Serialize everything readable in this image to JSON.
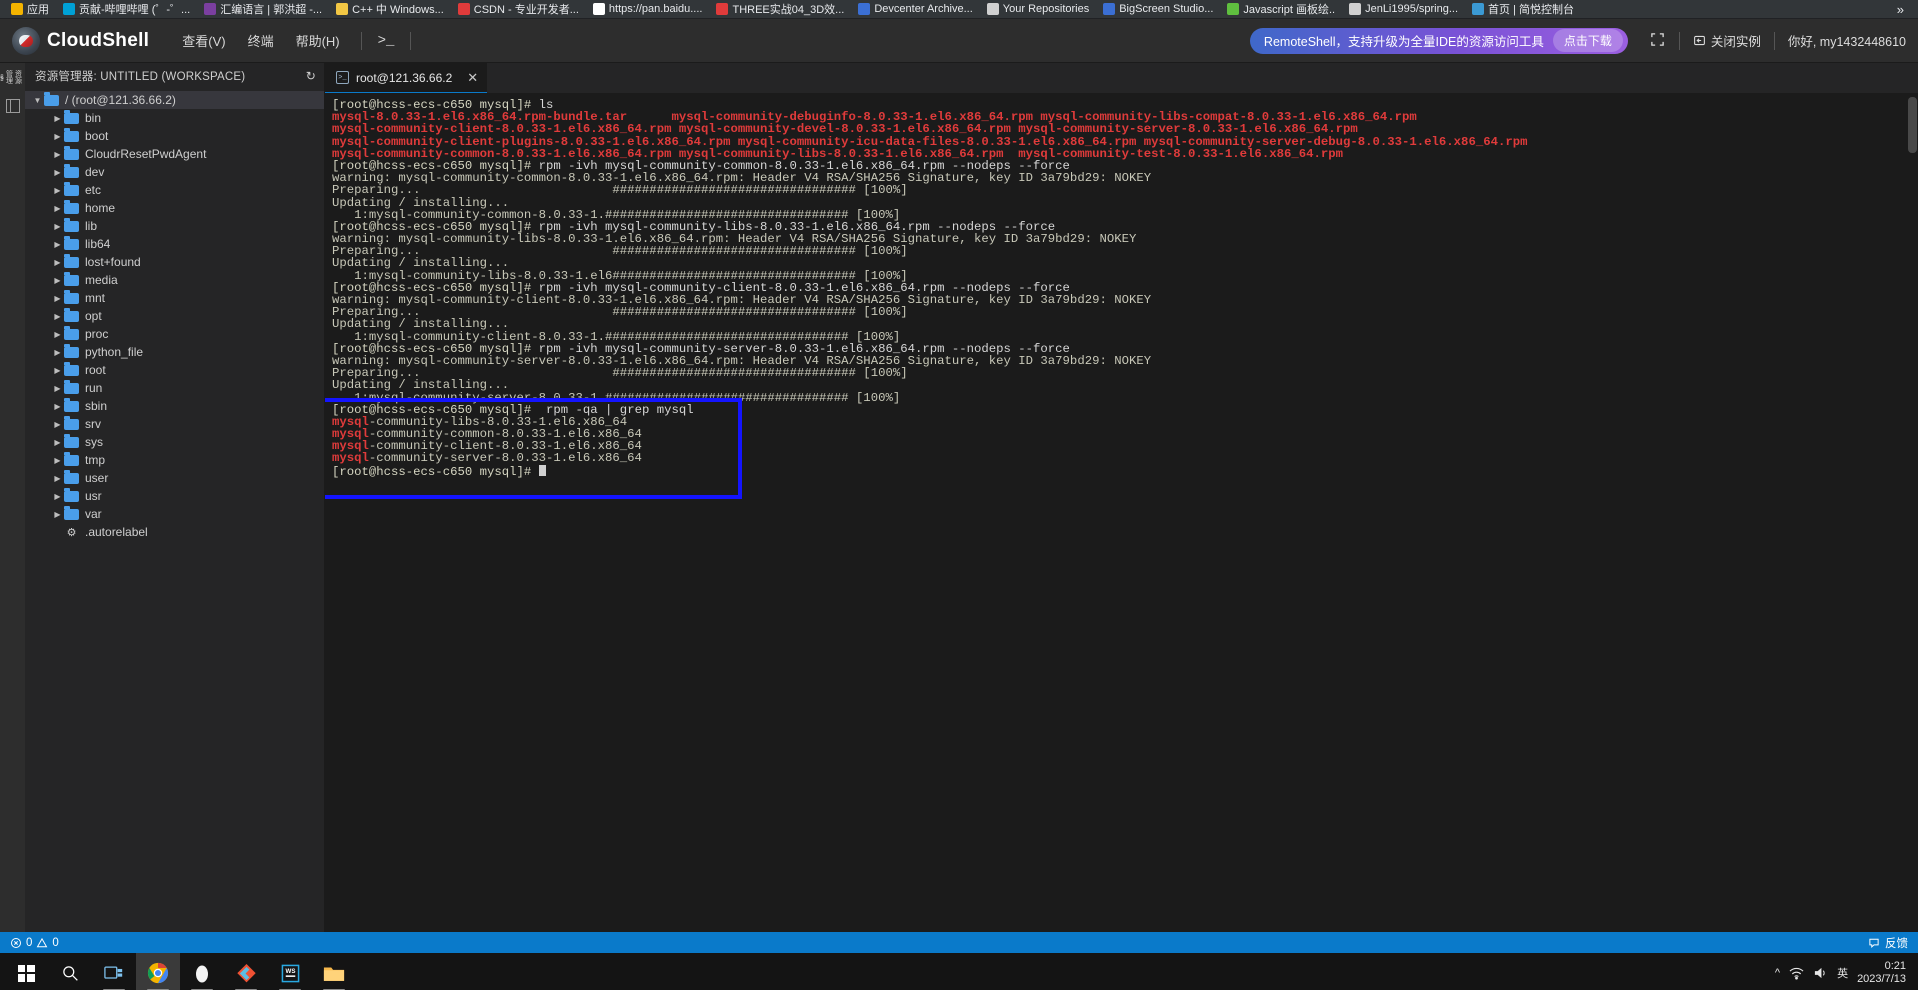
{
  "browser": {
    "bookmarks": [
      {
        "label": "应用",
        "icon": "apps-grid-icon",
        "color": "#f4b400"
      },
      {
        "label": "贡献-哔哩哔哩 (゜-゜...",
        "icon": "bilibili-icon",
        "color": "#00a1d6"
      },
      {
        "label": "汇编语言 | 郭洪超 -...",
        "icon": "note-icon",
        "color": "#7b3fa0"
      },
      {
        "label": "C++ 中 Windows...",
        "icon": "document-icon",
        "color": "#f2c744"
      },
      {
        "label": "CSDN - 专业开发者...",
        "icon": "csdn-icon",
        "color": "#e03b3b"
      },
      {
        "label": "https://pan.baidu....",
        "icon": "baidu-icon",
        "color": "#ffffff"
      },
      {
        "label": "THREE实战04_3D效...",
        "icon": "csdn-icon",
        "color": "#e03b3b"
      },
      {
        "label": "Devcenter Archive...",
        "icon": "devcenter-icon",
        "color": "#3b6fd4"
      },
      {
        "label": "Your Repositories",
        "icon": "github-icon",
        "color": "#d0d0d0"
      },
      {
        "label": "BigScreen Studio...",
        "icon": "bigscreen-icon",
        "color": "#3b6fd4"
      },
      {
        "label": "Javascript 画板绘..",
        "icon": "leaf-icon",
        "color": "#5fbf3f"
      },
      {
        "label": "JenLi1995/spring...",
        "icon": "github-icon",
        "color": "#d0d0d0"
      },
      {
        "label": "首页 | 简悦控制台",
        "icon": "console-icon",
        "color": "#3b9ad4"
      }
    ],
    "overflow": "»"
  },
  "header": {
    "app_title": "CloudShell",
    "logo_icon": "cloudshell-logo-icon",
    "menus": [
      {
        "label": "查看(V)",
        "name": "menu-view"
      },
      {
        "label": "终端",
        "name": "menu-terminal"
      },
      {
        "label": "帮助(H)",
        "name": "menu-help"
      }
    ],
    "terminal_icon_glyph": ">_",
    "promo_text": "RemoteShell，支持升级为全量IDE的资源访问工具",
    "promo_cta": "点击下载",
    "fullscreen_icon": "fullscreen-icon",
    "close_instance": "关闭实例",
    "close_instance_icon": "power-close-icon",
    "greeting": "你好, my1432448610"
  },
  "rail": {
    "items": [
      {
        "label": "资源管理器",
        "name": "rail-explorer"
      },
      {
        "label": "",
        "name": "rail-files"
      }
    ]
  },
  "explorer": {
    "title": "资源管理器: UNTITLED (WORKSPACE)",
    "refresh_icon": "refresh-icon",
    "root": {
      "label": "/ (root@121.36.66.2)",
      "expanded": true
    },
    "items": [
      {
        "label": "bin",
        "type": "folder"
      },
      {
        "label": "boot",
        "type": "folder"
      },
      {
        "label": "CloudrResetPwdAgent",
        "type": "folder"
      },
      {
        "label": "dev",
        "type": "folder"
      },
      {
        "label": "etc",
        "type": "folder"
      },
      {
        "label": "home",
        "type": "folder"
      },
      {
        "label": "lib",
        "type": "folder"
      },
      {
        "label": "lib64",
        "type": "folder"
      },
      {
        "label": "lost+found",
        "type": "folder"
      },
      {
        "label": "media",
        "type": "folder"
      },
      {
        "label": "mnt",
        "type": "folder"
      },
      {
        "label": "opt",
        "type": "folder"
      },
      {
        "label": "proc",
        "type": "folder"
      },
      {
        "label": "python_file",
        "type": "folder"
      },
      {
        "label": "root",
        "type": "folder"
      },
      {
        "label": "run",
        "type": "folder"
      },
      {
        "label": "sbin",
        "type": "folder"
      },
      {
        "label": "srv",
        "type": "folder"
      },
      {
        "label": "sys",
        "type": "folder"
      },
      {
        "label": "tmp",
        "type": "folder"
      },
      {
        "label": "user",
        "type": "folder"
      },
      {
        "label": "usr",
        "type": "folder"
      },
      {
        "label": "var",
        "type": "folder"
      },
      {
        "label": ".autorelabel",
        "type": "file"
      }
    ]
  },
  "terminal": {
    "tab_label": "root@121.36.66.2",
    "tab_icon": "terminal-icon",
    "tab_close_icon": "close-icon",
    "prompt": "[root@hcss-ecs-c650 mysql]#",
    "annotation_color": "#1414ff",
    "lines": [
      {
        "type": "cmd",
        "prompt": "[root@hcss-ecs-c650 mysql]# ",
        "text": "ls"
      },
      {
        "type": "cols",
        "cols": [
          "mysql-8.0.33-1.el6.x86_64.rpm-bundle.tar",
          "mysql-community-debuginfo-8.0.33-1.el6.x86_64.rpm",
          "mysql-community-libs-compat-8.0.33-1.el6.x86_64.rpm"
        ]
      },
      {
        "type": "cols",
        "cols": [
          "mysql-community-client-8.0.33-1.el6.x86_64.rpm",
          "mysql-community-devel-8.0.33-1.el6.x86_64.rpm",
          "mysql-community-server-8.0.33-1.el6.x86_64.rpm"
        ]
      },
      {
        "type": "cols",
        "cols": [
          "mysql-community-client-plugins-8.0.33-1.el6.x86_64.rpm",
          "mysql-community-icu-data-files-8.0.33-1.el6.x86_64.rpm",
          "mysql-community-server-debug-8.0.33-1.el6.x86_64.rpm"
        ]
      },
      {
        "type": "cols",
        "cols": [
          "mysql-community-common-8.0.33-1.el6.x86_64.rpm",
          "mysql-community-libs-8.0.33-1.el6.x86_64.rpm",
          "mysql-community-test-8.0.33-1.el6.x86_64.rpm"
        ]
      },
      {
        "type": "cmd",
        "prompt": "[root@hcss-ecs-c650 mysql]# ",
        "text": "rpm -ivh mysql-community-common-8.0.33-1.el6.x86_64.rpm --nodeps --force"
      },
      {
        "type": "out",
        "text": "warning: mysql-community-common-8.0.33-1.el6.x86_64.rpm: Header V4 RSA/SHA256 Signature, key ID 3a79bd29: NOKEY"
      },
      {
        "type": "out",
        "text": "Preparing...                          ################################# [100%]"
      },
      {
        "type": "out",
        "text": "Updating / installing..."
      },
      {
        "type": "out",
        "text": "   1:mysql-community-common-8.0.33-1.################################# [100%]"
      },
      {
        "type": "cmd",
        "prompt": "[root@hcss-ecs-c650 mysql]# ",
        "text": "rpm -ivh mysql-community-libs-8.0.33-1.el6.x86_64.rpm --nodeps --force"
      },
      {
        "type": "out",
        "text": "warning: mysql-community-libs-8.0.33-1.el6.x86_64.rpm: Header V4 RSA/SHA256 Signature, key ID 3a79bd29: NOKEY"
      },
      {
        "type": "out",
        "text": "Preparing...                          ################################# [100%]"
      },
      {
        "type": "out",
        "text": "Updating / installing..."
      },
      {
        "type": "out",
        "text": "   1:mysql-community-libs-8.0.33-1.el6################################# [100%]"
      },
      {
        "type": "cmd",
        "prompt": "[root@hcss-ecs-c650 mysql]# ",
        "text": "rpm -ivh mysql-community-client-8.0.33-1.el6.x86_64.rpm --nodeps --force"
      },
      {
        "type": "out",
        "text": "warning: mysql-community-client-8.0.33-1.el6.x86_64.rpm: Header V4 RSA/SHA256 Signature, key ID 3a79bd29: NOKEY"
      },
      {
        "type": "out",
        "text": "Preparing...                          ################################# [100%]"
      },
      {
        "type": "out",
        "text": "Updating / installing..."
      },
      {
        "type": "out",
        "text": "   1:mysql-community-client-8.0.33-1.################################# [100%]"
      },
      {
        "type": "cmd",
        "prompt": "[root@hcss-ecs-c650 mysql]# ",
        "text": "rpm -ivh mysql-community-server-8.0.33-1.el6.x86_64.rpm --nodeps --force"
      },
      {
        "type": "out",
        "text": "warning: mysql-community-server-8.0.33-1.el6.x86_64.rpm: Header V4 RSA/SHA256 Signature, key ID 3a79bd29: NOKEY"
      },
      {
        "type": "out",
        "text": "Preparing...                          ################################# [100%]"
      },
      {
        "type": "out",
        "text": "Updating / installing..."
      },
      {
        "type": "out",
        "text": "   1:mysql-community-server-8.0.33-1.################################# [100%]"
      },
      {
        "type": "cmd",
        "prompt": "[root@hcss-ecs-c650 mysql]#  ",
        "text": "rpm -qa | grep mysql"
      },
      {
        "type": "pkg",
        "hl": "mysql",
        "rest": "-community-libs-8.0.33-1.el6.x86_64"
      },
      {
        "type": "pkg",
        "hl": "mysql",
        "rest": "-community-common-8.0.33-1.el6.x86_64"
      },
      {
        "type": "pkg",
        "hl": "mysql",
        "rest": "-community-client-8.0.33-1.el6.x86_64"
      },
      {
        "type": "pkg",
        "hl": "mysql",
        "rest": "-community-server-8.0.33-1.el6.x86_64"
      },
      {
        "type": "cursor",
        "prompt": "[root@hcss-ecs-c650 mysql]# "
      }
    ]
  },
  "statusbar": {
    "error_icon": "error-circle-icon",
    "error_count": "0",
    "warning_icon": "warning-triangle-icon",
    "warning_count": "0",
    "feedback_icon": "feedback-icon",
    "feedback_label": "反馈"
  },
  "taskbar": {
    "start_icon": "windows-start-icon",
    "search_icon": "search-icon",
    "items": [
      {
        "name": "taskview-button",
        "icon": "task-view-icon",
        "running": true
      },
      {
        "name": "chrome-button",
        "icon": "chrome-icon",
        "running": true,
        "active": true
      },
      {
        "name": "app-button",
        "icon": "white-egg-icon",
        "running": true
      },
      {
        "name": "git-button",
        "icon": "git-diamond-icon",
        "running": true
      },
      {
        "name": "wps-button",
        "icon": "wps-icon",
        "running": true
      },
      {
        "name": "explorer-button",
        "icon": "file-explorer-icon",
        "running": true
      }
    ],
    "tray": {
      "chevron": "^",
      "icons": [
        "network-icon",
        "volume-icon"
      ],
      "ime": "英",
      "time": "0:21",
      "date": "2023/7/13"
    }
  }
}
